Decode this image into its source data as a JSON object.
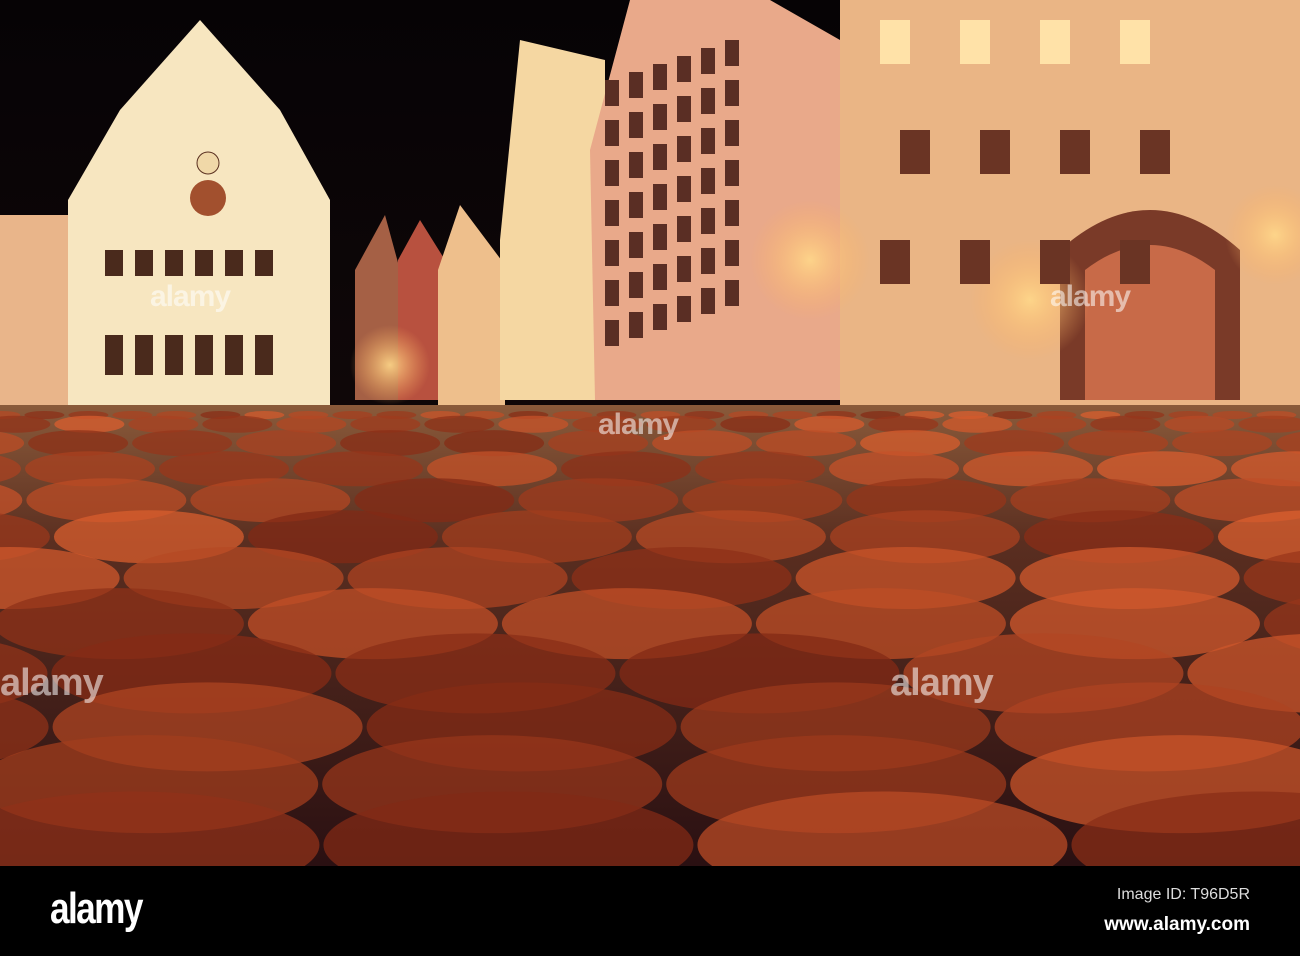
{
  "photo": {
    "subject": "Market square with half-timbered houses and cobblestones at night"
  },
  "watermark": {
    "text": "alamy"
  },
  "footer": {
    "logo": "alamy",
    "image_id": "Image ID: T96D5R",
    "site": "www.alamy.com"
  },
  "colors": {
    "sky": "#0b0608",
    "facade_light": "#f6e3b8",
    "facade_warm": "#e8a873",
    "cobble": "#6b3a24",
    "glow": "#ffcf7a"
  }
}
